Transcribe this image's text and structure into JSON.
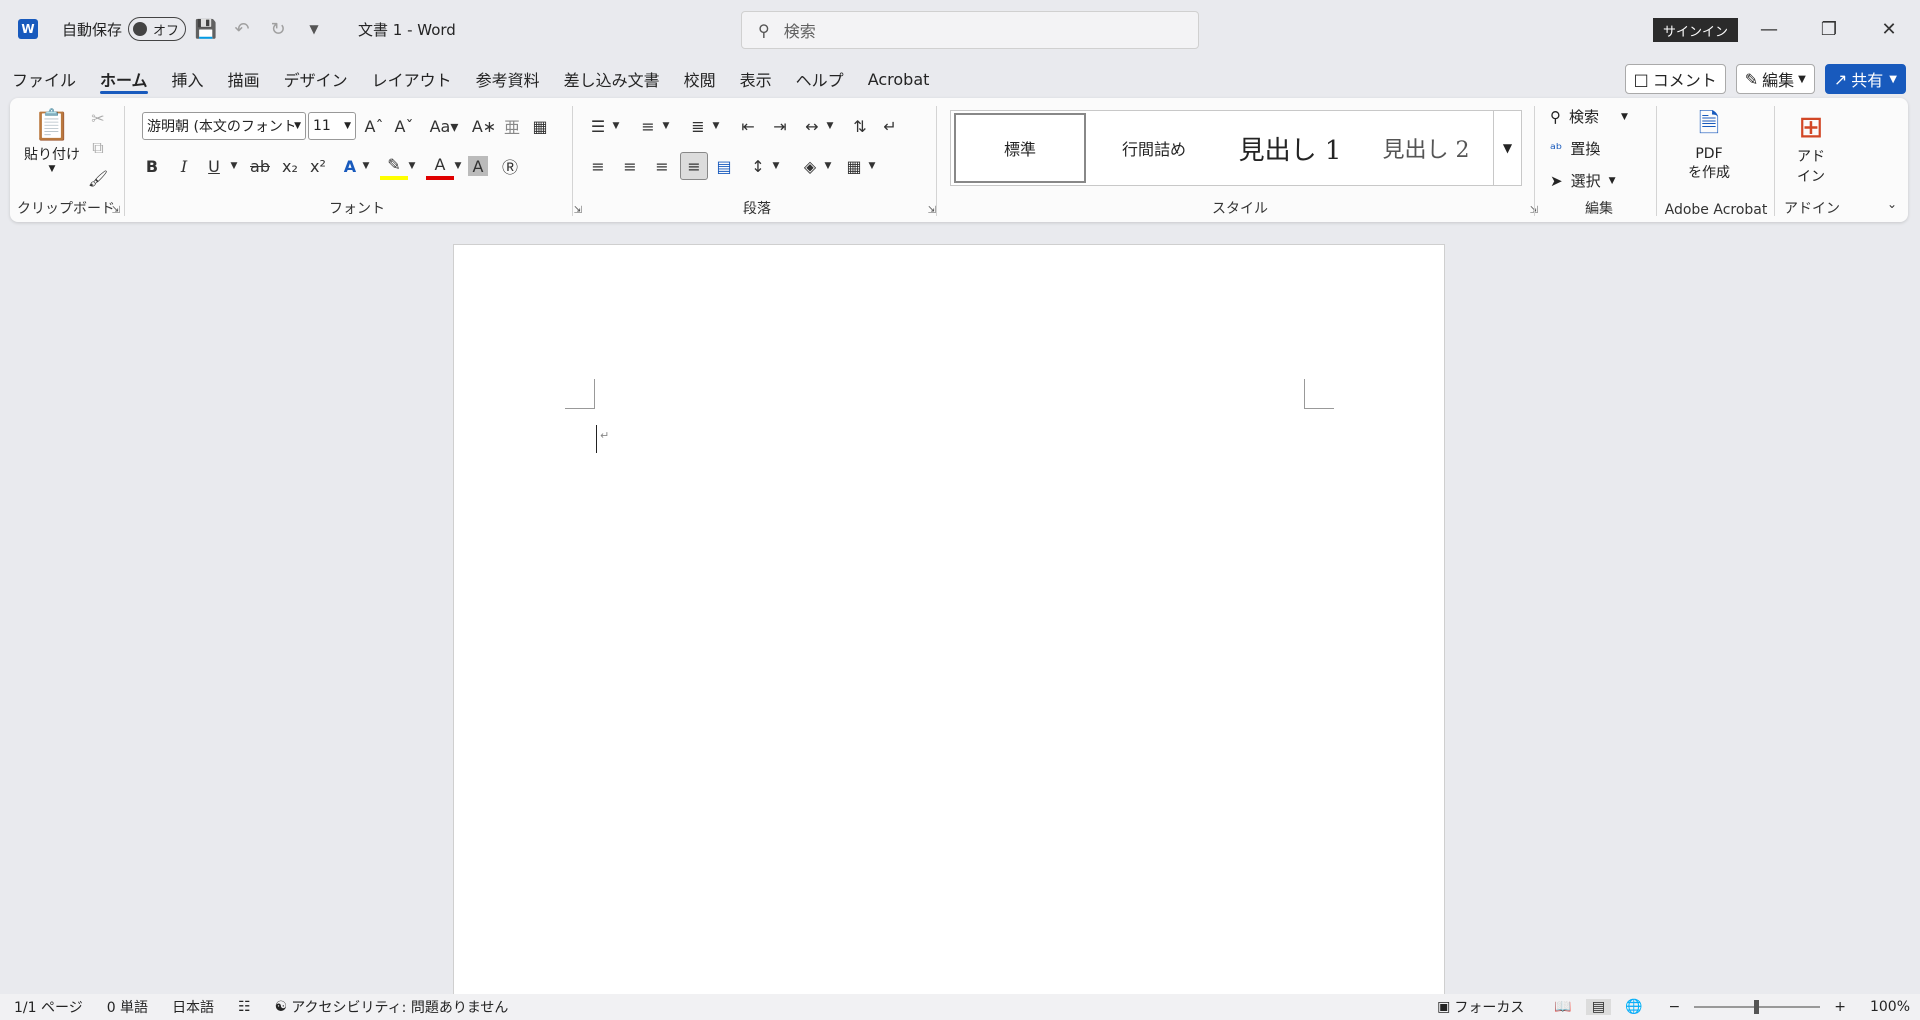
{
  "titlebar": {
    "logo": "W",
    "autosave_label": "自動保存",
    "autosave_state": "オフ",
    "doc_title": "文書 1 - Word",
    "search_placeholder": "検索",
    "signin": "サインイン"
  },
  "menu": [
    "ファイル",
    "ホーム",
    "挿入",
    "描画",
    "デザイン",
    "レイアウト",
    "参考資料",
    "差し込み文書",
    "校閲",
    "表示",
    "ヘルプ",
    "Acrobat"
  ],
  "right_buttons": {
    "comment": "コメント",
    "edit": "編集",
    "share": "共有"
  },
  "ribbon": {
    "clipboard": {
      "label": "クリップボード",
      "paste": "貼り付け"
    },
    "font": {
      "label": "フォント",
      "font_name": "游明朝 (本文のフォント",
      "font_size": "11"
    },
    "paragraph": {
      "label": "段落"
    },
    "styles": {
      "label": "スタイル",
      "items": [
        "標準",
        "行間詰め",
        "見出し 1",
        "見出し 2"
      ]
    },
    "editing": {
      "label": "編集",
      "find": "検索",
      "replace": "置換",
      "select": "選択"
    },
    "acrobat": {
      "label": "Adobe Acrobat",
      "pdf_line1": "PDF",
      "pdf_line2": "を作成"
    },
    "addin": {
      "label": "アドイン",
      "line1": "アド",
      "line2": "イン"
    }
  },
  "statusbar": {
    "page": "1/1 ページ",
    "words": "0 単語",
    "language": "日本語",
    "accessibility": "アクセシビリティ: 問題ありません",
    "focus": "フォーカス",
    "zoom": "100%"
  },
  "colors": {
    "accent": "#185abd",
    "save_icon": "#8e3d9f",
    "highlight": "#ffff00",
    "font_color": "#e00000"
  }
}
